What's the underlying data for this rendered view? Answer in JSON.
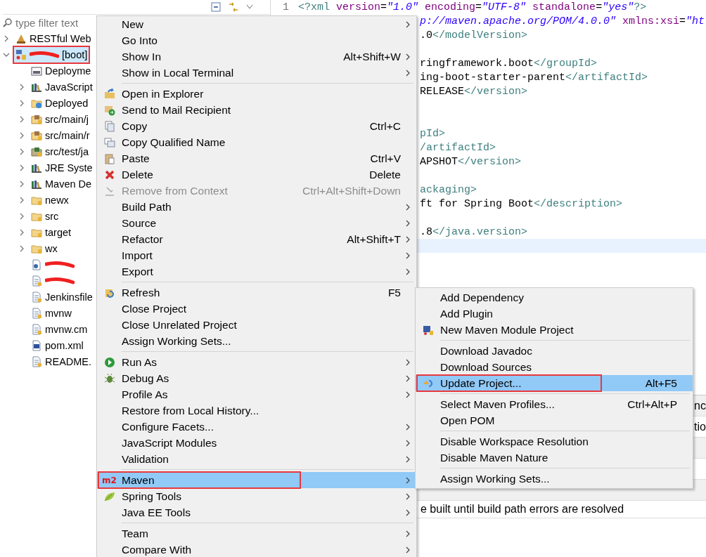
{
  "explorer": {
    "filter": {
      "placeholder": "type filter text"
    },
    "tree": [
      {
        "label": "RESTful Web",
        "kind": "service",
        "expanded": false,
        "selected": false,
        "outlined": false,
        "redacted": false
      },
      {
        "label": "[boot]",
        "kind": "project",
        "expanded": true,
        "selected": true,
        "outlined": true,
        "redacted": true,
        "children": [
          {
            "label": "Deployme",
            "kind": "descriptor",
            "selected": false,
            "outlined": false,
            "redacted": false
          },
          {
            "label": "JavaScript",
            "kind": "library",
            "expanded": false,
            "selected": false,
            "outlined": false,
            "redacted": false
          },
          {
            "label": "Deployed",
            "kind": "web-folder",
            "expanded": false,
            "selected": false,
            "outlined": false,
            "redacted": false
          },
          {
            "label": "src/main/j",
            "kind": "source-folder",
            "expanded": false,
            "selected": false,
            "outlined": false,
            "redacted": false
          },
          {
            "label": "src/main/r",
            "kind": "source-folder",
            "expanded": false,
            "selected": false,
            "outlined": false,
            "redacted": false
          },
          {
            "label": "src/test/ja",
            "kind": "test-folder",
            "expanded": false,
            "selected": false,
            "outlined": false,
            "redacted": false
          },
          {
            "label": "JRE Syste",
            "kind": "library",
            "expanded": false,
            "selected": false,
            "outlined": false,
            "redacted": false
          },
          {
            "label": "Maven De",
            "kind": "library",
            "expanded": false,
            "selected": false,
            "outlined": false,
            "redacted": false
          },
          {
            "label": "newx",
            "kind": "folder",
            "expanded": false,
            "selected": false,
            "outlined": false,
            "redacted": false
          },
          {
            "label": "src",
            "kind": "folder",
            "expanded": false,
            "selected": false,
            "outlined": false,
            "redacted": false
          },
          {
            "label": "target",
            "kind": "folder",
            "expanded": false,
            "selected": false,
            "outlined": false,
            "redacted": false
          },
          {
            "label": "wx",
            "kind": "folder",
            "expanded": false,
            "selected": false,
            "outlined": false,
            "redacted": false
          },
          {
            "kind": "sql-file",
            "selected": false,
            "outlined": false,
            "redacted": true
          },
          {
            "kind": "file",
            "selected": false,
            "outlined": false,
            "redacted": true
          },
          {
            "label": "Jenkinsfile",
            "kind": "file",
            "selected": false,
            "outlined": false,
            "redacted": false
          },
          {
            "label": "mvnw",
            "kind": "file",
            "selected": false,
            "outlined": false,
            "redacted": false
          },
          {
            "label": "mvnw.cm",
            "kind": "file",
            "selected": false,
            "outlined": false,
            "redacted": false
          },
          {
            "label": "pom.xml",
            "kind": "xml-file",
            "selected": false,
            "outlined": false,
            "redacted": false
          },
          {
            "label": "README.",
            "kind": "file",
            "selected": false,
            "outlined": false,
            "redacted": false
          }
        ]
      }
    ]
  },
  "editor": {
    "lines": [
      {
        "number": "1",
        "current": false,
        "segments": [
          {
            "text": "<?xml",
            "kind": "tag"
          },
          {
            "text": " version",
            "kind": "attr"
          },
          {
            "text": "=",
            "kind": "text"
          },
          {
            "text": "\"1.0\"",
            "kind": "value"
          },
          {
            "text": " encoding",
            "kind": "attr"
          },
          {
            "text": "=",
            "kind": "text"
          },
          {
            "text": "\"UTF-8\"",
            "kind": "value"
          },
          {
            "text": " standalone",
            "kind": "attr"
          },
          {
            "text": "=",
            "kind": "text"
          },
          {
            "text": "\"yes\"",
            "kind": "value"
          },
          {
            "text": "?>",
            "kind": "tag"
          }
        ]
      },
      {
        "current": false,
        "segments": [
          {
            "text": "p://maven.apache.org/POM/4.0.0\"",
            "kind": "value"
          },
          {
            "text": " xmlns:xsi",
            "kind": "attr"
          },
          {
            "text": "=",
            "kind": "text"
          },
          {
            "text": "\"ht",
            "kind": "value"
          }
        ]
      },
      {
        "current": false,
        "segments": [
          {
            "text": ".0",
            "kind": "text"
          },
          {
            "text": "</modelVersion>",
            "kind": "tag"
          }
        ]
      },
      {
        "kind": "blank"
      },
      {
        "current": false,
        "segments": [
          {
            "text": "ringframework.boot",
            "kind": "text"
          },
          {
            "text": "</groupId>",
            "kind": "tag"
          }
        ]
      },
      {
        "current": false,
        "segments": [
          {
            "text": "ing-boot-starter-parent",
            "kind": "text"
          },
          {
            "text": "</artifactId>",
            "kind": "tag"
          }
        ]
      },
      {
        "current": false,
        "segments": [
          {
            "text": "RELEASE",
            "kind": "text"
          },
          {
            "text": "</version>",
            "kind": "tag"
          }
        ]
      },
      {
        "kind": "blank"
      },
      {
        "kind": "blank"
      },
      {
        "current": false,
        "segments": [
          {
            "text": "pId>",
            "kind": "tag"
          }
        ]
      },
      {
        "current": false,
        "segments": [
          {
            "text": "/artifactId>",
            "kind": "tag"
          }
        ]
      },
      {
        "current": false,
        "segments": [
          {
            "text": "APSHOT",
            "kind": "text"
          },
          {
            "text": "</version>",
            "kind": "tag"
          }
        ]
      },
      {
        "kind": "blank"
      },
      {
        "current": false,
        "segments": [
          {
            "text": "ackaging>",
            "kind": "tag"
          }
        ]
      },
      {
        "current": false,
        "segments": [
          {
            "text": "ft for Spring Boot",
            "kind": "text"
          },
          {
            "text": "</description>",
            "kind": "tag"
          }
        ]
      },
      {
        "kind": "blank"
      },
      {
        "current": false,
        "segments": [
          {
            "text": ".8",
            "kind": "text"
          },
          {
            "text": "</java.version>",
            "kind": "tag"
          }
        ]
      },
      {
        "current": true
      }
    ]
  },
  "problems": {
    "rows": [
      {
        "column_1": "nc"
      },
      {
        "column_1": "tio"
      }
    ],
    "message": "e built until build path errors are resolved"
  },
  "context_menu": {
    "items": [
      {
        "label": "New",
        "submenu": true,
        "selected": false,
        "outlined": false
      },
      {
        "label": "Go Into",
        "selected": false,
        "outlined": false
      },
      {
        "label": "Show In",
        "shortcut": "Alt+Shift+W",
        "submenu": true,
        "selected": false,
        "outlined": false
      },
      {
        "label": "Show in Local Terminal",
        "submenu": true,
        "selected": false,
        "outlined": false
      },
      {
        "kind": "separator"
      },
      {
        "label": "Open in Explorer",
        "selected": false,
        "outlined": false
      },
      {
        "label": "Send to Mail Recipient",
        "selected": false,
        "outlined": false
      },
      {
        "label": "Copy",
        "shortcut": "Ctrl+C",
        "selected": false,
        "outlined": false
      },
      {
        "label": "Copy Qualified Name",
        "selected": false,
        "outlined": false
      },
      {
        "label": "Paste",
        "shortcut": "Ctrl+V",
        "selected": false,
        "outlined": false
      },
      {
        "label": "Delete",
        "shortcut": "Delete",
        "selected": false,
        "outlined": false
      },
      {
        "label": "Remove from Context",
        "shortcut": "Ctrl+Alt+Shift+Down",
        "disabled": true,
        "selected": false,
        "outlined": false
      },
      {
        "label": "Build Path",
        "submenu": true,
        "selected": false,
        "outlined": false
      },
      {
        "label": "Source",
        "submenu": true,
        "selected": false,
        "outlined": false
      },
      {
        "label": "Refactor",
        "shortcut": "Alt+Shift+T",
        "submenu": true,
        "selected": false,
        "outlined": false
      },
      {
        "label": "Import",
        "submenu": true,
        "selected": false,
        "outlined": false
      },
      {
        "label": "Export",
        "submenu": true,
        "selected": false,
        "outlined": false
      },
      {
        "kind": "separator"
      },
      {
        "label": "Refresh",
        "shortcut": "F5",
        "selected": false,
        "outlined": false
      },
      {
        "label": "Close Project",
        "selected": false,
        "outlined": false
      },
      {
        "label": "Close Unrelated Project",
        "selected": false,
        "outlined": false
      },
      {
        "label": "Assign Working Sets...",
        "selected": false,
        "outlined": false
      },
      {
        "kind": "separator"
      },
      {
        "label": "Run As",
        "submenu": true,
        "selected": false,
        "outlined": false
      },
      {
        "label": "Debug As",
        "submenu": true,
        "selected": false,
        "outlined": false
      },
      {
        "label": "Profile As",
        "submenu": true,
        "selected": false,
        "outlined": false
      },
      {
        "label": "Restore from Local History...",
        "selected": false,
        "outlined": false
      },
      {
        "label": "Configure Facets...",
        "submenu": true,
        "selected": false,
        "outlined": false
      },
      {
        "label": "JavaScript Modules",
        "submenu": true,
        "selected": false,
        "outlined": false
      },
      {
        "label": "Validation",
        "submenu": true,
        "selected": false,
        "outlined": false
      },
      {
        "kind": "separator"
      },
      {
        "label": "Maven",
        "badge": "m2",
        "submenu": true,
        "selected": true,
        "outlined": true
      },
      {
        "label": "Spring Tools",
        "submenu": true,
        "selected": false,
        "outlined": false
      },
      {
        "label": "Java EE Tools",
        "submenu": true,
        "selected": false,
        "outlined": false
      },
      {
        "kind": "separator"
      },
      {
        "label": "Team",
        "submenu": true,
        "selected": false,
        "outlined": false
      },
      {
        "label": "Compare With",
        "submenu": true,
        "selected": false,
        "outlined": false
      }
    ]
  },
  "maven_submenu": {
    "items": [
      {
        "label": "Add Dependency",
        "selected": false,
        "outlined": false
      },
      {
        "label": "Add Plugin",
        "selected": false,
        "outlined": false
      },
      {
        "label": "New Maven Module Project",
        "selected": false,
        "outlined": false
      },
      {
        "kind": "separator"
      },
      {
        "label": "Download Javadoc",
        "selected": false,
        "outlined": false
      },
      {
        "label": "Download Sources",
        "selected": false,
        "outlined": false
      },
      {
        "label": "Update Project...",
        "shortcut": "Alt+F5",
        "selected": true,
        "outlined": true
      },
      {
        "kind": "separator"
      },
      {
        "label": "Select Maven Profiles...",
        "shortcut": "Ctrl+Alt+P",
        "selected": false,
        "outlined": false
      },
      {
        "label": "Open POM",
        "selected": false,
        "outlined": false
      },
      {
        "kind": "separator"
      },
      {
        "label": "Disable Workspace Resolution",
        "selected": false,
        "outlined": false
      },
      {
        "label": "Disable Maven Nature",
        "selected": false,
        "outlined": false
      },
      {
        "kind": "separator"
      },
      {
        "label": "Assign Working Sets...",
        "selected": false,
        "outlined": false
      }
    ]
  }
}
